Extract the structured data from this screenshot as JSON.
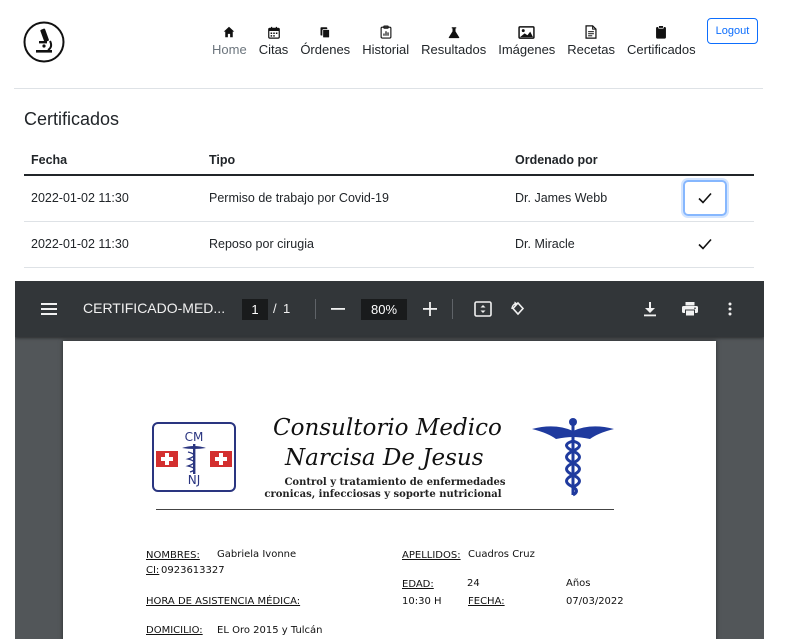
{
  "nav": {
    "items": [
      {
        "label": "Home",
        "icon": "house-icon"
      },
      {
        "label": "Citas",
        "icon": "calendar-icon"
      },
      {
        "label": "Órdenes",
        "icon": "files-icon"
      },
      {
        "label": "Historial",
        "icon": "clipboard-data-icon"
      },
      {
        "label": "Resultados",
        "icon": "flask-icon"
      },
      {
        "label": "Imágenes",
        "icon": "image-icon"
      },
      {
        "label": "Recetas",
        "icon": "file-text-icon"
      },
      {
        "label": "Certificados",
        "icon": "clipboard-icon"
      }
    ],
    "active": "Home",
    "logout": "Logout"
  },
  "page": {
    "title": "Certificados"
  },
  "table": {
    "headers": [
      "Fecha",
      "Tipo",
      "Ordenado por"
    ],
    "rows": [
      {
        "fecha": "2022-01-02 11:30",
        "tipo": "Permiso de trabajo por Covid-19",
        "ordenado_por": "Dr. James Webb",
        "action_icon": "check-icon"
      },
      {
        "fecha": "2022-01-02 11:30",
        "tipo": "Reposo por cirugia",
        "ordenado_por": "Dr. Miracle",
        "action_icon": "check-icon"
      }
    ]
  },
  "pdf": {
    "title": "CERTIFICADO-MED...",
    "page": "1",
    "separator": "/",
    "total_pages": "1",
    "zoom": "80%",
    "document": {
      "logo_text_top": "CM",
      "logo_text_bottom": "NJ",
      "heading_line1": "Consultorio Medico",
      "heading_line2": "Narcisa De Jesus",
      "subheading_line1": "Control y tratamiento  de enfermedades",
      "subheading_line2": "cronicas, infecciosas y soporte nutricional",
      "fields": {
        "nombres_label": "NOMBRES:",
        "nombres_value": "Gabriela Ivonne",
        "apellidos_label": "APELLIDOS:",
        "apellidos_value": "Cuadros Cruz",
        "ci_label": "CI:",
        "ci_value": "0923613327",
        "edad_label": "EDAD:",
        "edad_value": "24",
        "edad_unit": "Años",
        "hora_label": "HORA DE ASISTENCIA MÉDICA:",
        "hora_value": "10:30 H",
        "fecha_label": "FECHA:",
        "fecha_value": "07/03/2022",
        "domicilio_label": "DOMICILIO:",
        "domicilio_value": "EL Oro 2015 y Tulcán"
      }
    }
  },
  "colors": {
    "primary": "#0d6efd",
    "toolbar": "#323639",
    "viewer_bg": "#525659",
    "logo_blue": "#1f3a9e",
    "logo_red": "#d32f2f"
  }
}
